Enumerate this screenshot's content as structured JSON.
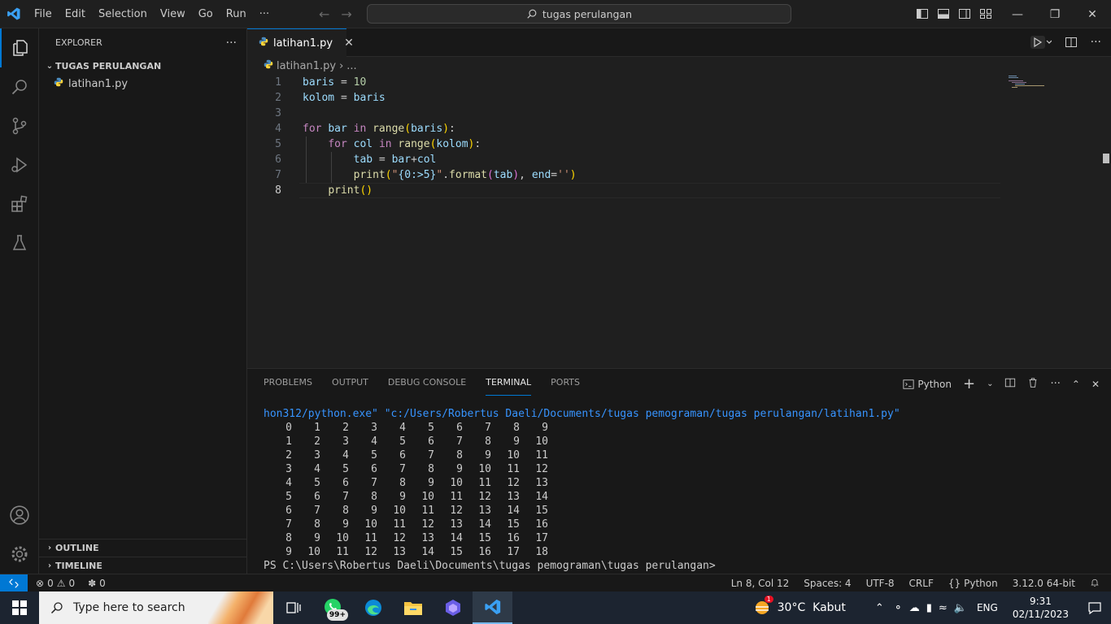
{
  "titlebar": {
    "menus": [
      "File",
      "Edit",
      "Selection",
      "View",
      "Go",
      "Run",
      "···"
    ],
    "search_text": "tugas perulangan"
  },
  "sidebar": {
    "title": "EXPLORER",
    "more": "···",
    "folder": "TUGAS PERULANGAN",
    "file": "latihan1.py",
    "outline": "OUTLINE",
    "timeline": "TIMELINE"
  },
  "editor": {
    "tab_label": "latihan1.py",
    "breadcrumb_file": "latihan1.py",
    "breadcrumb_more": "...",
    "line_numbers": [
      "1",
      "2",
      "3",
      "4",
      "5",
      "6",
      "7",
      "8"
    ]
  },
  "panel": {
    "tabs": [
      "PROBLEMS",
      "OUTPUT",
      "DEBUG CONSOLE",
      "TERMINAL",
      "PORTS"
    ],
    "active_tab": "TERMINAL",
    "terminal_profile": "Python",
    "command_line": "hon312/python.exe\" \"c:/Users/Robertus Daeli/Documents/tugas pemograman/tugas perulangan/latihan1.py\"",
    "output_rows": [
      [
        "0",
        "1",
        "2",
        "3",
        "4",
        "5",
        "6",
        "7",
        "8",
        "9"
      ],
      [
        "1",
        "2",
        "3",
        "4",
        "5",
        "6",
        "7",
        "8",
        "9",
        "10"
      ],
      [
        "2",
        "3",
        "4",
        "5",
        "6",
        "7",
        "8",
        "9",
        "10",
        "11"
      ],
      [
        "3",
        "4",
        "5",
        "6",
        "7",
        "8",
        "9",
        "10",
        "11",
        "12"
      ],
      [
        "4",
        "5",
        "6",
        "7",
        "8",
        "9",
        "10",
        "11",
        "12",
        "13"
      ],
      [
        "5",
        "6",
        "7",
        "8",
        "9",
        "10",
        "11",
        "12",
        "13",
        "14"
      ],
      [
        "6",
        "7",
        "8",
        "9",
        "10",
        "11",
        "12",
        "13",
        "14",
        "15"
      ],
      [
        "7",
        "8",
        "9",
        "10",
        "11",
        "12",
        "13",
        "14",
        "15",
        "16"
      ],
      [
        "8",
        "9",
        "10",
        "11",
        "12",
        "13",
        "14",
        "15",
        "16",
        "17"
      ],
      [
        "9",
        "10",
        "11",
        "12",
        "13",
        "14",
        "15",
        "16",
        "17",
        "18"
      ]
    ],
    "prompt": "PS C:\\Users\\Robertus Daeli\\Documents\\tugas pemograman\\tugas perulangan>"
  },
  "statusbar": {
    "errors": "0",
    "warnings": "0",
    "ports": "0",
    "position": "Ln 8, Col 12",
    "spaces": "Spaces: 4",
    "encoding": "UTF-8",
    "eol": "CRLF",
    "language": "Python",
    "interpreter": "3.12.0 64-bit"
  },
  "taskbar": {
    "search_placeholder": "Type here to search",
    "whatsapp_badge": "99+",
    "weather_alert": "1",
    "weather": "30°C  Kabut",
    "language": "ENG",
    "time": "9:31",
    "date": "02/11/2023"
  },
  "colors": {
    "accent": "#0078d4",
    "keyword": "#c586c0",
    "variable": "#9cdcfe",
    "number": "#b5cea8",
    "function": "#dcdcaa",
    "string": "#ce9178",
    "terminal_path": "#3794ff"
  },
  "icons": [
    "vscode-logo-icon",
    "explorer-icon",
    "search-icon",
    "source-control-icon",
    "run-debug-icon",
    "extensions-icon",
    "testing-icon",
    "account-icon",
    "settings-gear-icon",
    "python-file-icon",
    "close-icon",
    "run-icon",
    "split-editor-icon"
  ]
}
